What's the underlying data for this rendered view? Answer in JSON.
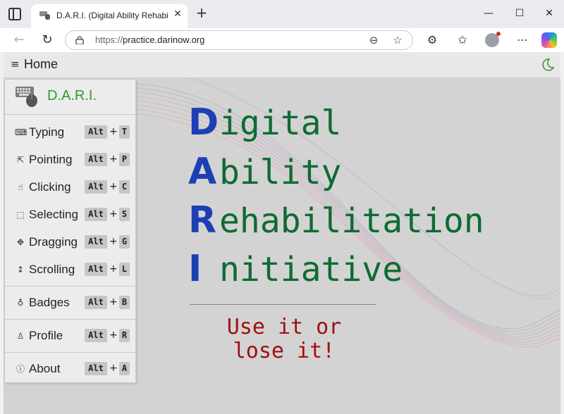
{
  "browser": {
    "tab_title": "D.A.R.I. (Digital Ability Rehabilitation Initiative)",
    "tab_close": "✕",
    "new_tab": "+",
    "window": {
      "minimize": "—",
      "maximize": "☐",
      "close": "✕"
    },
    "url_prefix": "https://",
    "url_host": "practice.darinow.org"
  },
  "header": {
    "menu_glyph": "≡",
    "title": "Home"
  },
  "sidebar": {
    "brand": "D.A.R.I.",
    "items": [
      {
        "label": "Typing",
        "modifier": "Alt",
        "key": "T",
        "icon_glyph": "⌨"
      },
      {
        "label": "Pointing",
        "modifier": "Alt",
        "key": "P",
        "icon_glyph": "⇱"
      },
      {
        "label": "Clicking",
        "modifier": "Alt",
        "key": "C",
        "icon_glyph": "☝"
      },
      {
        "label": "Selecting",
        "modifier": "Alt",
        "key": "S",
        "icon_glyph": "⬚"
      },
      {
        "label": "Dragging",
        "modifier": "Alt",
        "key": "G",
        "icon_glyph": "✥"
      },
      {
        "label": "Scrolling",
        "modifier": "Alt",
        "key": "L",
        "icon_glyph": "↕"
      },
      {
        "label": "Badges",
        "modifier": "Alt",
        "key": "B",
        "icon_glyph": "♁"
      },
      {
        "label": "Profile",
        "modifier": "Alt",
        "key": "R",
        "icon_glyph": "♙"
      },
      {
        "label": "About",
        "modifier": "Alt",
        "key": "A",
        "icon_glyph": "ⓘ"
      }
    ],
    "plus": "+"
  },
  "title": {
    "lines": [
      {
        "cap": "D",
        "rest": "igital"
      },
      {
        "cap": "A",
        "rest": "bility"
      },
      {
        "cap": "R",
        "rest": "ehabilitation"
      },
      {
        "cap": "I",
        "rest": "nitiative"
      }
    ],
    "motto_line1": "Use it or",
    "motto_line2": "lose it!"
  },
  "colors": {
    "brand_green": "#2e9b2e",
    "acronym_blue": "#1d3fb5",
    "word_green": "#0e6b32",
    "motto_red": "#a01010",
    "page_bg": "#d3d3d3"
  }
}
